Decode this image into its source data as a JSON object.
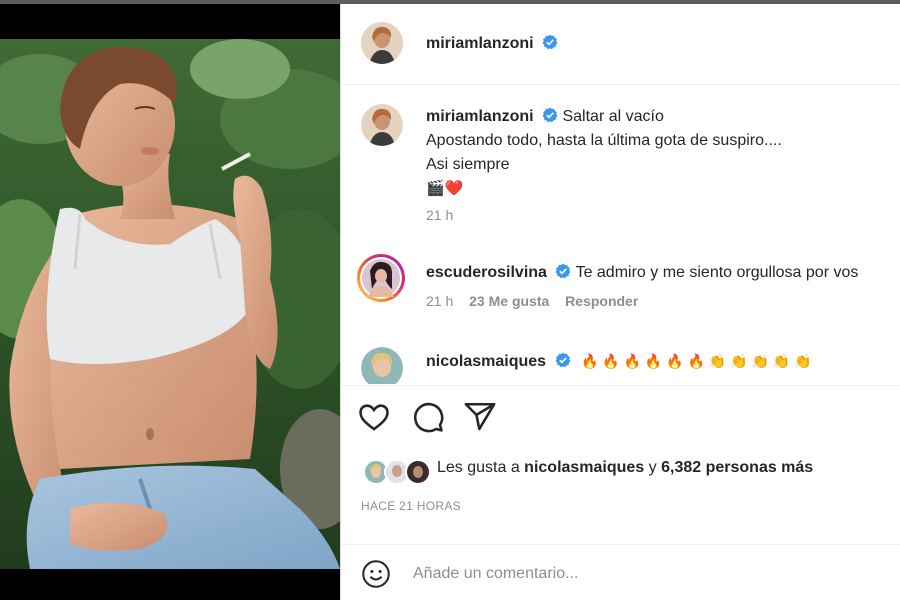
{
  "post": {
    "author": "miriamlanzoni",
    "caption": {
      "username": "miriamlanzoni",
      "title": "Saltar al vacío",
      "line1": "Apostando todo, hasta la última gota de suspiro....",
      "line2": "Asi siempre",
      "emojis": "🎬❤️",
      "time": "21 h"
    },
    "comments": [
      {
        "username": "escuderosilvina",
        "text": "Te admiro y me siento orgullosa por vos",
        "time": "21 h",
        "likes": "23 Me gusta",
        "reply": "Responder"
      },
      {
        "username": "nicolasmaiques",
        "text": "🔥 🔥 🔥 🔥 🔥 🔥 👏 👏 👏 👏 👏"
      }
    ],
    "likes": {
      "prefix": "Les gusta a ",
      "user": "nicolasmaiques",
      "middle": " y ",
      "count": "6,382 personas más"
    },
    "posted": "HACE 21 HORAS",
    "add_comment_placeholder": "Añade un comentario..."
  },
  "icons": {
    "like": "heart-icon",
    "comment": "comment-bubble-icon",
    "share": "paper-plane-icon",
    "emoji": "smiley-icon",
    "verified": "verified-badge-icon"
  },
  "colors": {
    "verified": "#3897f0",
    "heart": "#ed4956",
    "text": "#262626",
    "muted": "#8e8e8e"
  }
}
